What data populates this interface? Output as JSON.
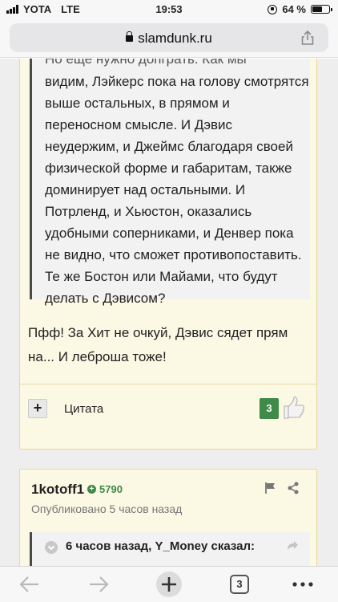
{
  "status_bar": {
    "carrier": "YOTA",
    "network": "LTE",
    "time": "19:53",
    "battery": "64 %",
    "battery_level": 0.64
  },
  "browser": {
    "url": "slamdunk.ru",
    "tab_count": "3"
  },
  "post_1": {
    "quote_cut_line": "Но еще нужно допграть. Как мы",
    "quote_text": "видим, Лэйкерс пока на голову смотрятся выше остальных, в прямом и переносном смысле. И Дэвис неудержим, и Джеймс благодаря своей физической форме и габаритам, также доминирует над остальными. И Потрленд, и Хьюстон, оказались удобными соперниками, и Денвер пока не видно, что сможет противопоставить. Те же Бостон или Майами, что будут делать с Дэвисом?",
    "reply_text": "Пфф! За Хит не очкуй, Дэвис сядет прям на... И леброша тоже!",
    "plus_label": "+",
    "quote_button_label": "Цитата",
    "like_count": "3"
  },
  "post_2": {
    "author": "1kotoff1",
    "reputation": "5790",
    "published": "Опубликовано 5 часов назад",
    "quote_header": "6 часов назад, Y_Money сказал:"
  },
  "colors": {
    "post_bg": "#fbf8e3",
    "post_border": "#e8d89a",
    "quote_bg": "#f2f2f2",
    "reputation_green": "#3f8a48"
  }
}
